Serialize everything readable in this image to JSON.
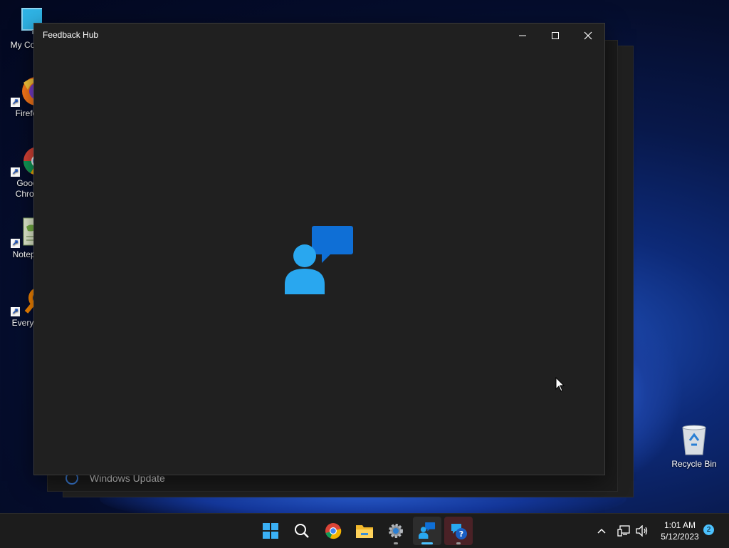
{
  "desktop": {
    "icons": [
      {
        "label": "My Com"
      },
      {
        "label": "Firefo"
      },
      {
        "label": "Goog Chron"
      },
      {
        "label": "Notepa"
      },
      {
        "label": "Everyth"
      }
    ],
    "recycle_bin": {
      "label": "Recycle Bin"
    }
  },
  "background_window": {
    "item_label": "Windows Update"
  },
  "window": {
    "title": "Feedback Hub",
    "splash_icon": "feedback-hub-icon"
  },
  "taskbar": {
    "apps": [
      {
        "name": "start-icon"
      },
      {
        "name": "search-icon"
      },
      {
        "name": "chrome-icon"
      },
      {
        "name": "file-explorer-icon"
      },
      {
        "name": "settings-icon"
      },
      {
        "name": "feedback-hub-icon"
      },
      {
        "name": "get-help-icon"
      }
    ],
    "clock": {
      "time": "1:01 AM",
      "date": "5/12/2023"
    },
    "notification_count": "2"
  },
  "colors": {
    "accent": "#4cc2ff",
    "window_bg": "#202020",
    "taskbar_bg": "#1c1c1c"
  }
}
